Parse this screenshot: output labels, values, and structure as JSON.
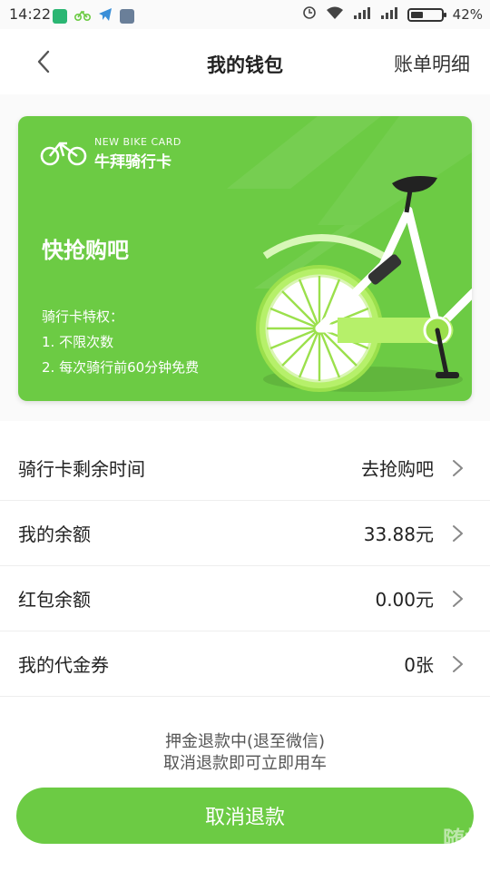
{
  "status_bar": {
    "time": "14:22",
    "battery": "42%",
    "battery_level": 0.42,
    "icons": [
      "shield-app-icon",
      "bike-app-icon",
      "telegram-icon",
      "notes-app-icon",
      "alarm-icon",
      "wifi-icon",
      "signal-icon",
      "signal-icon",
      "battery-icon"
    ]
  },
  "nav": {
    "back_icon": "chevron-left-icon",
    "title": "我的钱包",
    "right_label": "账单明细"
  },
  "card": {
    "logo_en": "NEW BIKE CARD",
    "logo_cn": "牛拜骑行卡",
    "headline": "快抢购吧",
    "perks_title": "骑行卡特权：",
    "perks": [
      "1. 不限次数",
      "2. 每次骑行前60分钟免费"
    ],
    "color": "#6ccb44"
  },
  "list": [
    {
      "label": "骑行卡剩余时间",
      "value": "去抢购吧"
    },
    {
      "label": "我的余额",
      "value": "33.88元"
    },
    {
      "label": "红包余额",
      "value": "0.00元"
    },
    {
      "label": "我的代金券",
      "value": "0张"
    }
  ],
  "notice": {
    "line1": "押金退款中(退至微信)",
    "line2": "取消退款即可立即用车"
  },
  "cancel_button": {
    "label": "取消退款",
    "color": "#6ccb44"
  },
  "watermark": "随机"
}
